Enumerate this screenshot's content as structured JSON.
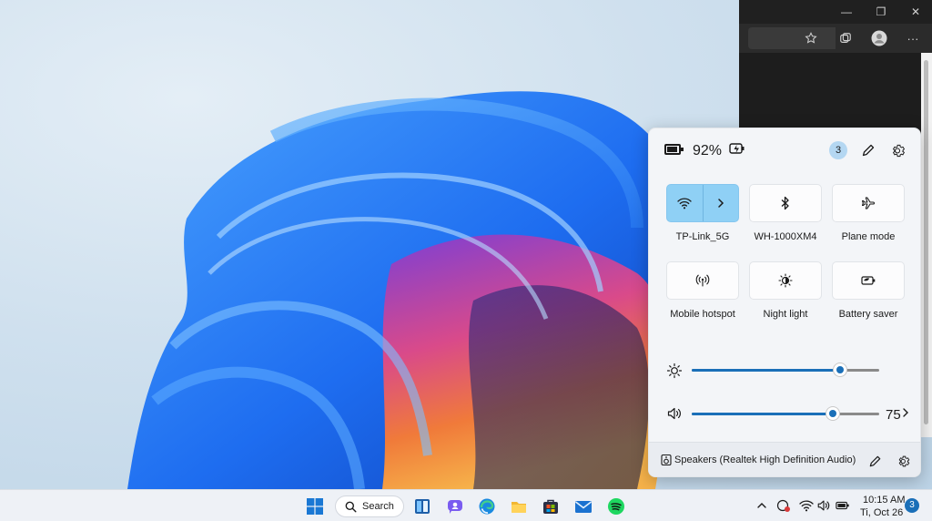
{
  "desktop": {
    "wallpaper": "bloom-wallpaper"
  },
  "browser": {
    "window_controls": {
      "minimize": "—",
      "restore": "❐",
      "close": "✕"
    },
    "toolbar_icons": [
      "favorites-star-icon",
      "collections-icon",
      "profile-avatar-icon",
      "more-icon"
    ],
    "more_glyph": "···"
  },
  "quick_settings": {
    "battery": {
      "percent": "92%",
      "charging": true
    },
    "notification_count": "3",
    "tiles": [
      {
        "id": "wifi",
        "label": "TP-Link_5G",
        "active": true,
        "icon": "wifi-icon"
      },
      {
        "id": "bluetooth",
        "label": "WH-1000XM4",
        "active": false,
        "icon": "bluetooth-icon"
      },
      {
        "id": "plane",
        "label": "Plane mode",
        "active": false,
        "icon": "airplane-icon"
      },
      {
        "id": "hotspot",
        "label": "Mobile hotspot",
        "active": false,
        "icon": "hotspot-icon"
      },
      {
        "id": "nightlight",
        "label": "Night light",
        "active": false,
        "icon": "night-light-icon"
      },
      {
        "id": "batterysaver",
        "label": "Battery saver",
        "active": false,
        "icon": "battery-saver-icon"
      }
    ],
    "brightness": {
      "level_fraction": 0.79
    },
    "volume": {
      "value": "75",
      "level_fraction": 0.75
    },
    "output_device": "Speakers (Realtek High Definition Audio)"
  },
  "taskbar": {
    "search_label": "Search",
    "apps": [
      "start-icon",
      "search",
      "widgets-icon",
      "chat-icon",
      "edge-icon",
      "file-explorer-icon",
      "store-icon",
      "mail-icon",
      "spotify-icon"
    ],
    "tray": {
      "overflow_glyph": "^",
      "time": "10:15 AM",
      "date": "Ti, Oct 26",
      "badge": "3"
    }
  },
  "colors": {
    "accent": "#1a6fb8",
    "tile_active": "#8fd0f5",
    "panel_bg": "#f3f5f8",
    "taskbar_bg": "#eef1f6"
  }
}
